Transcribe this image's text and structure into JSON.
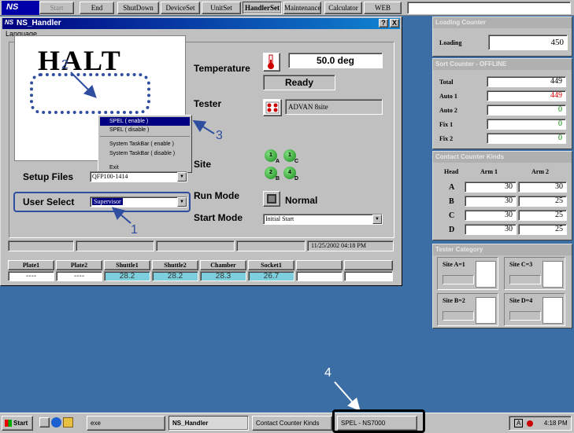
{
  "toolbar": {
    "logo": "NS",
    "buttons": [
      {
        "label": "Start",
        "state": "disabled"
      },
      {
        "label": "End",
        "state": "normal"
      },
      {
        "label": "ShutDown",
        "state": "normal"
      },
      {
        "label": "DeviceSet",
        "state": "normal"
      },
      {
        "label": "UnitSet",
        "state": "normal"
      },
      {
        "label": "HandlerSet",
        "state": "active"
      },
      {
        "label": "Maintenance",
        "state": "normal"
      },
      {
        "label": "Calculator",
        "state": "normal"
      },
      {
        "label": "WEB",
        "state": "normal"
      }
    ]
  },
  "window": {
    "icon": "NS",
    "title": "NS_Handler",
    "help": "?",
    "close": "X",
    "menu": [
      "Language"
    ]
  },
  "main": {
    "halt_text": "HALT",
    "context_menu": [
      {
        "label": "SPEL ( enable )",
        "highlighted": true
      },
      {
        "label": "SPEL ( disable )",
        "highlighted": false
      },
      {
        "label": "System TaskBar ( enable )",
        "highlighted": false
      },
      {
        "label": "System TaskBar ( disable )",
        "highlighted": false
      },
      {
        "label": "Exit",
        "highlighted": false
      }
    ],
    "setup_files_label": "Setup Files",
    "setup_files_value": "QFP100-1414",
    "user_select_label": "User Select",
    "user_select_value": "Supervisor",
    "temperature_label": "Temperature",
    "temperature_value": "50.0 deg",
    "status_value": "Ready",
    "tester_label": "Tester",
    "tester_value": "ADVAN 8site",
    "site_label": "Site",
    "sites": [
      {
        "num": "1",
        "letter": "A"
      },
      {
        "num": "1",
        "letter": "C"
      },
      {
        "num": "2",
        "letter": "B"
      },
      {
        "num": "4",
        "letter": "D"
      }
    ],
    "run_mode_label": "Run Mode",
    "run_mode_value": "Normal",
    "start_mode_label": "Start Mode",
    "start_mode_value": "Initial Start",
    "status_datetime": "11/25/2002 04:18 PM"
  },
  "position_table": {
    "headers": [
      "Plate1",
      "Plate2",
      "Shuttle1",
      "Shuttle2",
      "Chamber",
      "Socket1",
      "",
      ""
    ],
    "values": [
      "----",
      "----",
      "28.2",
      "28.2",
      "28.3",
      "26.7",
      "",
      ""
    ]
  },
  "annotations": [
    "1",
    "2",
    "3",
    "4"
  ],
  "loading_counter": {
    "title": "Loading Counter",
    "label": "Loading",
    "value": "450"
  },
  "sort_counter": {
    "title": "Sort Counter - OFFLINE",
    "rows": [
      {
        "label": "Total",
        "value": "449",
        "color": "#000000"
      },
      {
        "label": "Auto 1",
        "value": "449",
        "color": "#cc0000"
      },
      {
        "label": "Auto 2",
        "value": "0",
        "color": "#008000"
      },
      {
        "label": "Fix 1",
        "value": "0",
        "color": "#008000"
      },
      {
        "label": "Fix 2",
        "value": "0",
        "color": "#008000"
      }
    ]
  },
  "contact_counter": {
    "title": "Contact Counter Kinds",
    "headers": [
      "Head",
      "Arm 1",
      "Arm 2"
    ],
    "rows": [
      {
        "head": "A",
        "arm1": "30",
        "arm2": "30"
      },
      {
        "head": "B",
        "arm1": "30",
        "arm2": "25"
      },
      {
        "head": "C",
        "arm1": "30",
        "arm2": "25"
      },
      {
        "head": "D",
        "arm1": "30",
        "arm2": "25"
      }
    ]
  },
  "tester_category": {
    "title": "Tester Category",
    "sites": [
      "Site A=1",
      "Site C=3",
      "Site B=2",
      "Site D=4"
    ]
  },
  "taskbar": {
    "start": "Start",
    "tasks": [
      {
        "label": "exe"
      },
      {
        "label": "NS_Handler"
      },
      {
        "label": "Contact Counter Kinds"
      },
      {
        "label": "SPEL - NS7000"
      }
    ],
    "clock": "4:18 PM",
    "tray_text": "A"
  },
  "colors": {
    "desktop": "#3a6ea5",
    "title_active": "#000080",
    "annotation": "#2f4ea0",
    "site_green": "#1a8a1a",
    "temp_cell": "#7ecfdd"
  }
}
